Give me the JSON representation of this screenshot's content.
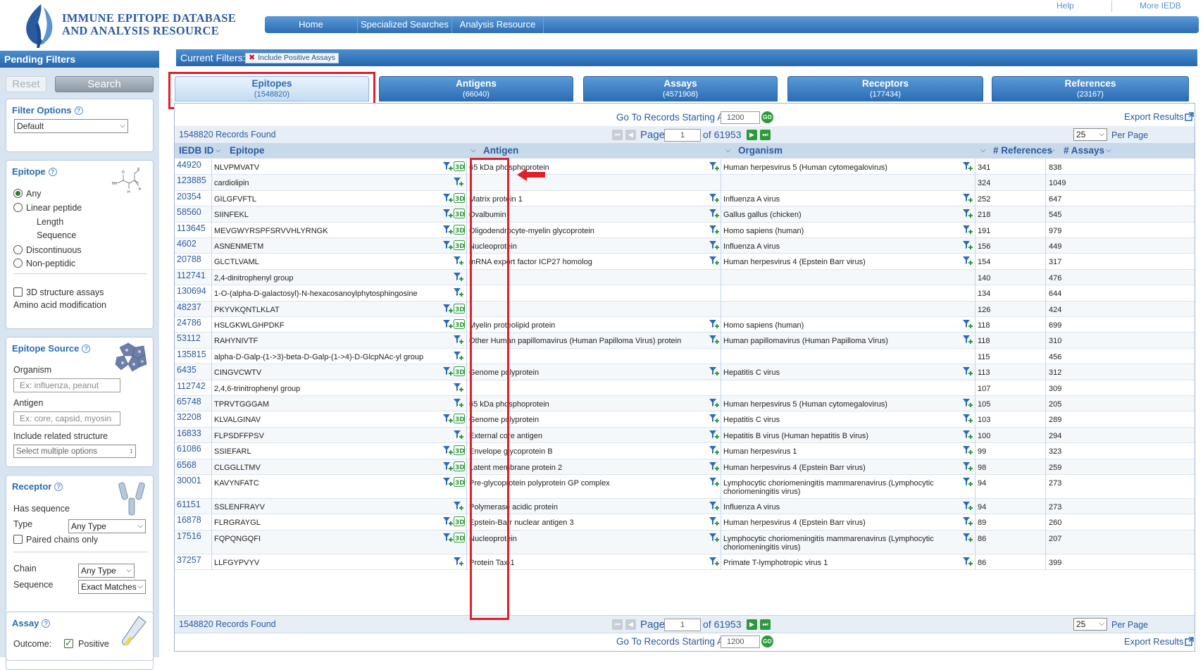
{
  "header": {
    "logo_line1": "IMMUNE EPITOPE DATABASE",
    "logo_line2": "AND ANALYSIS RESOURCE",
    "help": "Help",
    "more": "More IEDB",
    "nav": [
      "Home",
      "Specialized Searches",
      "Analysis Resource"
    ]
  },
  "pending": {
    "title": "Pending Filters",
    "reset": "Reset",
    "search": "Search",
    "filter_options": {
      "title": "Filter Options",
      "select": "Default"
    },
    "epitope": {
      "title": "Epitope",
      "any": "Any",
      "linear": "Linear peptide",
      "length": "Length",
      "sequence": "Sequence",
      "discontinuous": "Discontinuous",
      "nonpeptidic": "Non-peptidic",
      "structure": "3D structure assays",
      "amino": "Amino acid modification"
    },
    "source": {
      "title": "Epitope Source",
      "organism": "Organism",
      "organism_ph": "Ex: influenza, peanut",
      "antigen": "Antigen",
      "antigen_ph": "Ex: core, capsid, myosin",
      "related": "Include related structure",
      "multi": "Select multiple options"
    },
    "receptor": {
      "title": "Receptor",
      "has_seq": "Has sequence",
      "type": "Type",
      "type_val": "Any Type",
      "paired": "Paired chains only",
      "chain": "Chain",
      "chain_val": "Any Type",
      "sequence": "Sequence",
      "seq_val": "Exact Matches"
    },
    "assay": {
      "title": "Assay",
      "outcome": "Outcome:",
      "positive": "Positive"
    }
  },
  "current_filters": {
    "label": "Current Filters:",
    "chip": "Include Positive Assays"
  },
  "tabs": [
    {
      "label": "Epitopes",
      "count": "(1548820)"
    },
    {
      "label": "Antigens",
      "count": "(66040)"
    },
    {
      "label": "Assays",
      "count": "(4571908)"
    },
    {
      "label": "Receptors",
      "count": "(177434)"
    },
    {
      "label": "References",
      "count": "(23167)"
    }
  ],
  "results": {
    "goto_label": "Go To Records Starting At",
    "goto_value": "1200",
    "export": "Export Results",
    "records_found": "1548820 Records Found",
    "page_label": "Page",
    "page_value": "1",
    "of_pages": "of 61953",
    "per_page_value": "25",
    "per_page_label": "Per Page",
    "go": "GO"
  },
  "columns": [
    "IEDB ID",
    "Epitope",
    "Antigen",
    "Organism",
    "# References",
    "# Assays"
  ],
  "rows": [
    {
      "id": "44920",
      "epitope": "NLVPMVATV",
      "antigen": "65 kDa phosphoprotein",
      "organism": "Human herpesvirus 5 (Human cytomegalovirus)",
      "refs": "341",
      "assays": "838",
      "has3d": true
    },
    {
      "id": "123885",
      "epitope": "cardiolipin",
      "antigen": "",
      "organism": "",
      "refs": "324",
      "assays": "1049",
      "has3d": false
    },
    {
      "id": "20354",
      "epitope": "GILGFVFTL",
      "antigen": "Matrix protein 1",
      "organism": "Influenza A virus",
      "refs": "252",
      "assays": "647",
      "has3d": true
    },
    {
      "id": "58560",
      "epitope": "SIINFEKL",
      "antigen": "Ovalbumin",
      "organism": "Gallus gallus (chicken)",
      "refs": "218",
      "assays": "545",
      "has3d": true
    },
    {
      "id": "113645",
      "epitope": "MEVGWYRSPFSRVVHLYRNGK",
      "antigen": "Oligodendrocyte-myelin glycoprotein",
      "organism": "Homo sapiens (human)",
      "refs": "191",
      "assays": "979",
      "has3d": true
    },
    {
      "id": "4602",
      "epitope": "ASNENMETM",
      "antigen": "Nucleoprotein",
      "organism": "Influenza A virus",
      "refs": "156",
      "assays": "449",
      "has3d": true
    },
    {
      "id": "20788",
      "epitope": "GLCTLVAML",
      "antigen": "mRNA export factor ICP27 homolog",
      "organism": "Human herpesvirus 4 (Epstein Barr virus)",
      "refs": "154",
      "assays": "317",
      "has3d": false
    },
    {
      "id": "112741",
      "epitope": "2,4-dinitrophenyl group",
      "antigen": "",
      "organism": "",
      "refs": "140",
      "assays": "476",
      "has3d": false
    },
    {
      "id": "130694",
      "epitope": "1-O-(alpha-D-galactosyl)-N-hexacosanoylphytosphingosine",
      "antigen": "",
      "organism": "",
      "refs": "134",
      "assays": "644",
      "has3d": false
    },
    {
      "id": "48237",
      "epitope": "PKYVKQNTLKLAT",
      "antigen": "",
      "organism": "",
      "refs": "126",
      "assays": "424",
      "has3d": true
    },
    {
      "id": "24786",
      "epitope": "HSLGKWLGHPDKF",
      "antigen": "Myelin proteolipid protein",
      "organism": "Homo sapiens (human)",
      "refs": "118",
      "assays": "699",
      "has3d": true
    },
    {
      "id": "53112",
      "epitope": "RAHYNIVTF",
      "antigen": "Other Human papillomavirus (Human Papilloma Virus) protein",
      "organism": "Human papillomavirus (Human Papilloma Virus)",
      "refs": "118",
      "assays": "310",
      "has3d": false
    },
    {
      "id": "135815",
      "epitope": "alpha-D-Galp-(1->3)-beta-D-Galp-(1->4)-D-GlcpNAc-yl group",
      "antigen": "",
      "organism": "",
      "refs": "115",
      "assays": "456",
      "has3d": false
    },
    {
      "id": "6435",
      "epitope": "CINGVCWTV",
      "antigen": "Genome polyprotein",
      "organism": "Hepatitis C virus",
      "refs": "113",
      "assays": "312",
      "has3d": true
    },
    {
      "id": "112742",
      "epitope": "2,4,6-trinitrophenyl group",
      "antigen": "",
      "organism": "",
      "refs": "107",
      "assays": "309",
      "has3d": false
    },
    {
      "id": "65748",
      "epitope": "TPRVTGGGAM",
      "antigen": "65 kDa phosphoprotein",
      "organism": "Human herpesvirus 5 (Human cytomegalovirus)",
      "refs": "105",
      "assays": "205",
      "has3d": false
    },
    {
      "id": "32208",
      "epitope": "KLVALGINAV",
      "antigen": "Genome polyprotein",
      "organism": "Hepatitis C virus",
      "refs": "103",
      "assays": "289",
      "has3d": true
    },
    {
      "id": "16833",
      "epitope": "FLPSDFFPSV",
      "antigen": "External core antigen",
      "organism": "Hepatitis B virus (Human hepatitis B virus)",
      "refs": "100",
      "assays": "294",
      "has3d": false
    },
    {
      "id": "61086",
      "epitope": "SSIEFARL",
      "antigen": "Envelope glycoprotein B",
      "organism": "Human herpesvirus 1",
      "refs": "99",
      "assays": "323",
      "has3d": true
    },
    {
      "id": "6568",
      "epitope": "CLGGLLTMV",
      "antigen": "Latent membrane protein 2",
      "organism": "Human herpesvirus 4 (Epstein Barr virus)",
      "refs": "98",
      "assays": "259",
      "has3d": true
    },
    {
      "id": "30001",
      "epitope": "KAVYNFATC",
      "antigen": "Pre-glycoprotein polyprotein GP complex",
      "organism": "Lymphocytic choriomeningitis mammarenavirus (Lymphocytic choriomeningitis virus)",
      "refs": "94",
      "assays": "273",
      "has3d": true
    },
    {
      "id": "61151",
      "epitope": "SSLENFRAYV",
      "antigen": "Polymerase acidic protein",
      "organism": "Influenza A virus",
      "refs": "94",
      "assays": "273",
      "has3d": false
    },
    {
      "id": "16878",
      "epitope": "FLRGRAYGL",
      "antigen": "Epstein-Barr nuclear antigen 3",
      "organism": "Human herpesvirus 4 (Epstein Barr virus)",
      "refs": "89",
      "assays": "260",
      "has3d": true
    },
    {
      "id": "17516",
      "epitope": "FQPQNGQFI",
      "antigen": "Nucleoprotein",
      "organism": "Lymphocytic choriomeningitis mammarenavirus (Lymphocytic choriomeningitis virus)",
      "refs": "86",
      "assays": "207",
      "has3d": true
    },
    {
      "id": "37257",
      "epitope": "LLFGYPVYV",
      "antigen": "Protein Tax-1",
      "organism": "Primate T-lymphotropic virus 1",
      "refs": "86",
      "assays": "399",
      "has3d": false
    }
  ]
}
